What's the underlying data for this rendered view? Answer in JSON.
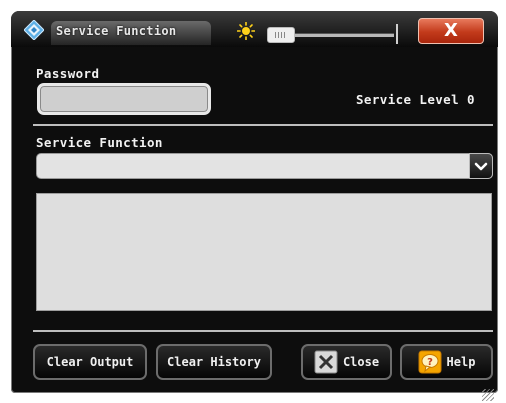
{
  "window": {
    "title": "Service Function",
    "close_glyph": "X",
    "icons": {
      "app": "rs-diamond-icon",
      "brightness": "sun-icon"
    }
  },
  "password": {
    "label": "Password",
    "value": "",
    "service_level": "Service Level 0"
  },
  "service_function": {
    "label": "Service Function",
    "selected": "",
    "dropdown_icon": "chevron-down-icon"
  },
  "output": {
    "text": ""
  },
  "buttons": {
    "clear_output": "Clear Output",
    "clear_history": "Clear History",
    "close": "Close",
    "help": "Help"
  },
  "colors": {
    "background": "#0d0d0d",
    "close_button": "#c23a1b",
    "help_icon": "#f5a500",
    "field": "#dedede"
  }
}
